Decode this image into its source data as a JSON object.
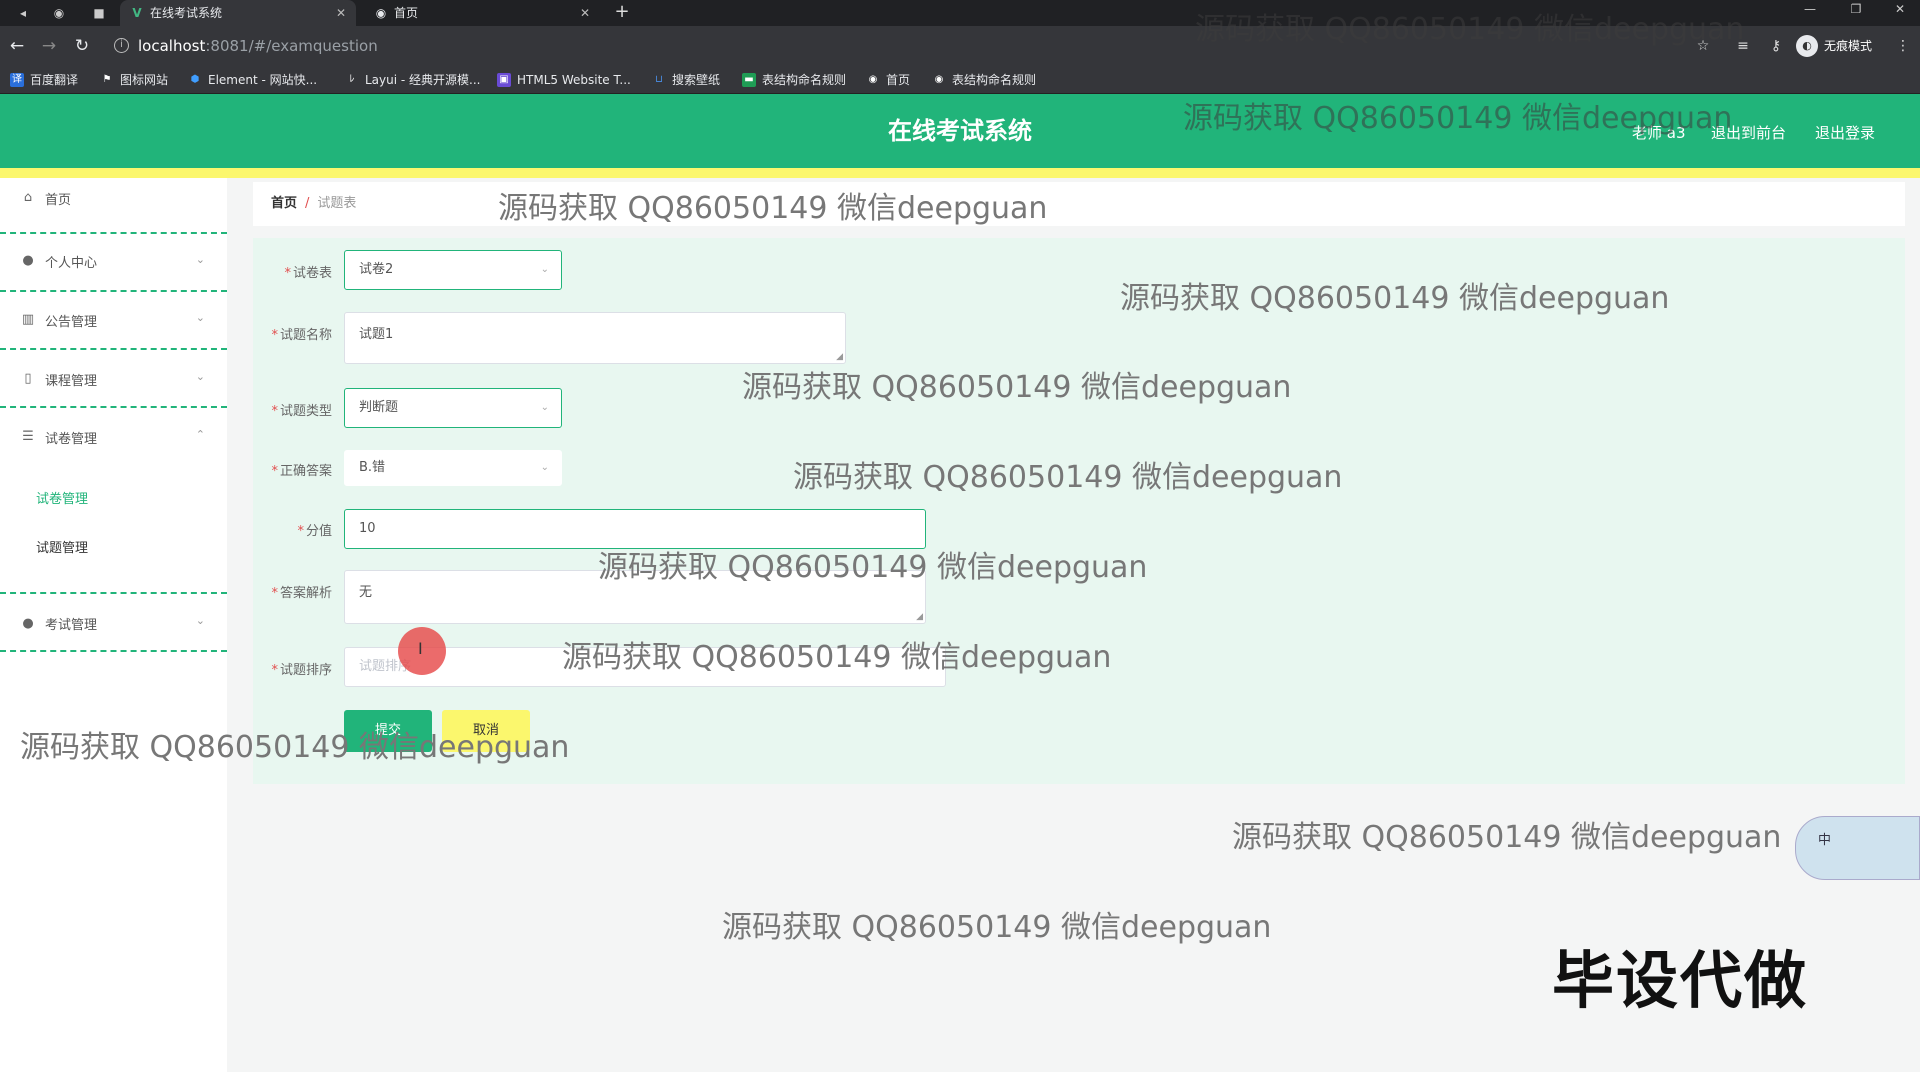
{
  "browser": {
    "tabs": [
      {
        "title": "在线考试系统",
        "favicon": "V",
        "active": true
      },
      {
        "title": "首页",
        "favicon": "globe-icon",
        "active": false
      }
    ],
    "url_host": "localhost",
    "url_path": ":8081/#/examquestion",
    "incognito_label": "无痕模式",
    "bookmarks": [
      "百度翻译",
      "图标网站",
      "Element - 网站快...",
      "Layui - 经典开源模...",
      "HTML5 Website T...",
      "搜索壁纸",
      "表结构命名规则",
      "首页",
      "表结构命名规则"
    ]
  },
  "header": {
    "title": "在线考试系统",
    "user": "老师 a3",
    "to_frontend": "退出到前台",
    "logout": "退出登录"
  },
  "sidebar": {
    "items": [
      {
        "label": "首页",
        "icon": "home-icon"
      },
      {
        "label": "个人中心",
        "icon": "user-icon"
      },
      {
        "label": "公告管理",
        "icon": "chart-icon"
      },
      {
        "label": "课程管理",
        "icon": "mic-icon"
      },
      {
        "label": "试卷管理",
        "icon": "sliders-icon"
      },
      {
        "label": "考试管理",
        "icon": "bulb-icon"
      }
    ],
    "sub_items": [
      "试卷管理",
      "试题管理"
    ]
  },
  "breadcrumb": {
    "home": "首页",
    "sep": "/",
    "current": "试题表"
  },
  "form": {
    "paper": {
      "label": "试卷表",
      "value": "试卷2"
    },
    "name": {
      "label": "试题名称",
      "value": "试题1"
    },
    "type": {
      "label": "试题类型",
      "value": "判断题"
    },
    "answer": {
      "label": "正确答案",
      "value": "B.错"
    },
    "score": {
      "label": "分值",
      "value": "10"
    },
    "analysis": {
      "label": "答案解析",
      "value": "无"
    },
    "order": {
      "label": "试题排序",
      "placeholder": "试题排序"
    },
    "submit": "提交",
    "cancel": "取消"
  },
  "watermarks": {
    "text": "源码获取 QQ86050149 微信deepguan",
    "big": "毕设代做"
  },
  "ime": {
    "label": "中"
  }
}
